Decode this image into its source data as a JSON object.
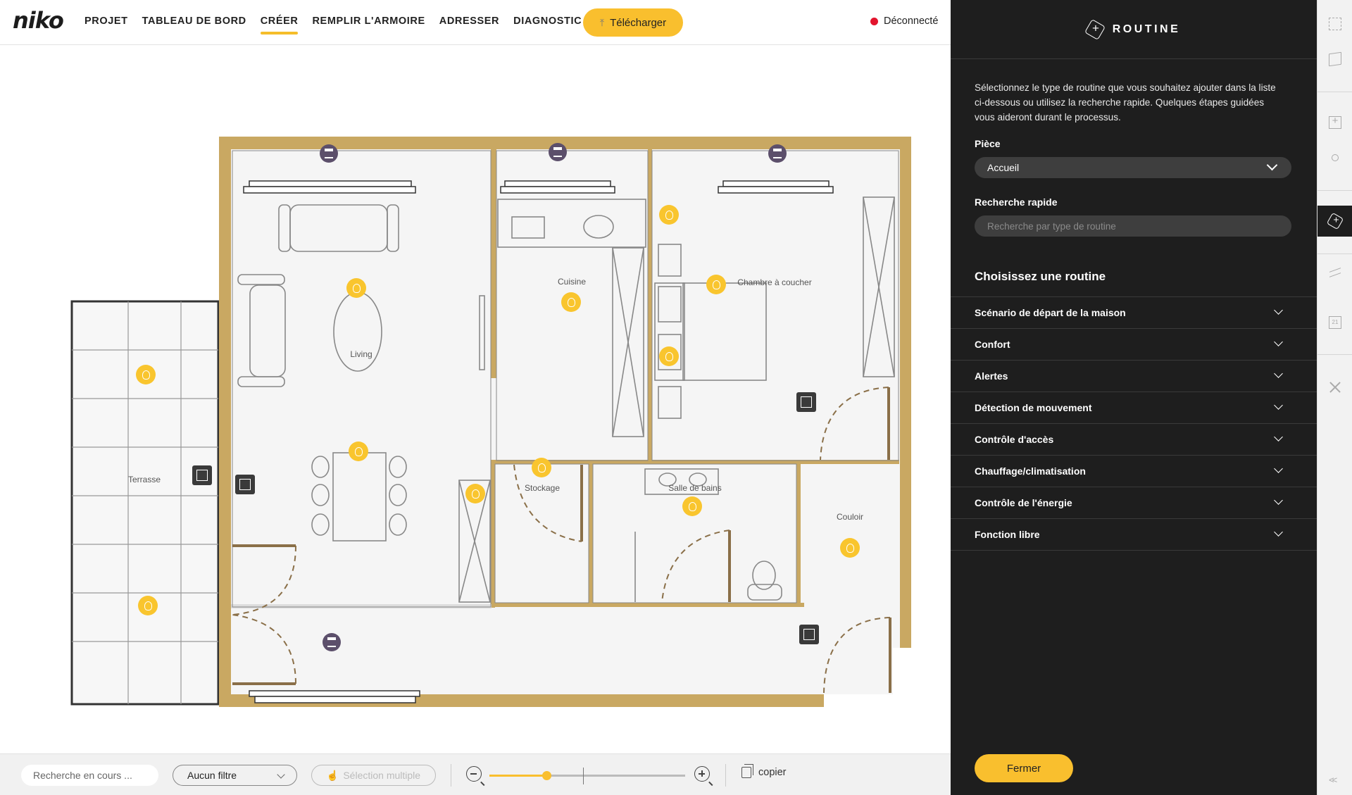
{
  "brand": {
    "logo": "niko",
    "accent": "#f9bf2e",
    "panel_bg": "#1e1e1e"
  },
  "nav": {
    "items": [
      {
        "label": "PROJET",
        "active": false
      },
      {
        "label": "TABLEAU DE BORD",
        "active": false
      },
      {
        "label": "CRÉER",
        "active": true
      },
      {
        "label": "REMPLIR L'ARMOIRE",
        "active": false
      },
      {
        "label": "ADRESSER",
        "active": false
      },
      {
        "label": "DIAGNOSTIC",
        "active": false,
        "external": true
      }
    ],
    "download_label": "Télécharger",
    "status_label": "Déconnecté",
    "status_color": "#e2142d"
  },
  "floorplan": {
    "rooms": [
      "Living",
      "Cuisine",
      "Chambre à coucher",
      "Terrasse",
      "Stockage",
      "Salle de bains",
      "Couloir"
    ],
    "markers": {
      "lights": 12,
      "shades": 4,
      "switches": 4
    }
  },
  "toolbar": {
    "search_placeholder": "Recherche en cours ...",
    "filter_label": "Aucun filtre",
    "multi_select_label": "Sélection multiple",
    "zoom_level": 0.29,
    "copy_label": "copier"
  },
  "panel": {
    "title": "ROUTINE",
    "intro": "Sélectionnez le type de routine que vous souhaitez ajouter dans la liste ci-dessous ou utilisez la recherche rapide. Quelques étapes guidées vous aideront durant le processus.",
    "room_label": "Pièce",
    "room_value": "Accueil",
    "quick_search_label": "Recherche rapide",
    "quick_search_placeholder": "Recherche par type de routine",
    "choose_title": "Choisissez une routine",
    "routines": [
      "Scénario de départ de la maison",
      "Confort",
      "Alertes",
      "Détection de mouvement",
      "Contrôle d'accès",
      "Chauffage/climatisation",
      "Contrôle de l'énergie",
      "Fonction libre"
    ],
    "close_label": "Fermer"
  },
  "rail": {
    "icons": [
      "expand-icon",
      "map-icon",
      "add-device-icon",
      "shapes-icon",
      "routine-icon",
      "share-icon",
      "calendar-icon",
      "tools-icon"
    ],
    "active": "routine-icon",
    "calendar_day": "21"
  }
}
